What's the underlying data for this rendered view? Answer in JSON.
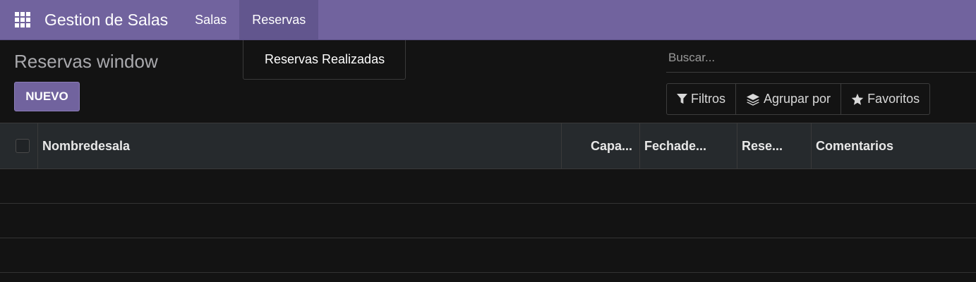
{
  "navbar": {
    "app_title": "Gestion de Salas",
    "menus": [
      {
        "label": "Salas"
      },
      {
        "label": "Reservas"
      }
    ],
    "dropdown_item": "Reservas Realizadas"
  },
  "page": {
    "title": "Reservas window",
    "new_button": "NUEVO"
  },
  "search": {
    "placeholder": "Buscar..."
  },
  "filters": {
    "filter_label": "Filtros",
    "group_label": "Agrupar por",
    "favorites_label": "Favoritos"
  },
  "table": {
    "columns": [
      "Nombredesala",
      "Capa...",
      "Fechade...",
      "Rese...",
      "Comentarios"
    ],
    "empty_rows": 3
  },
  "colors": {
    "navbar": "#71639e",
    "background": "#131313",
    "header_row": "#262a2d"
  },
  "icons": [
    "apps-grid-icon",
    "filter-icon",
    "layers-icon",
    "star-icon"
  ]
}
